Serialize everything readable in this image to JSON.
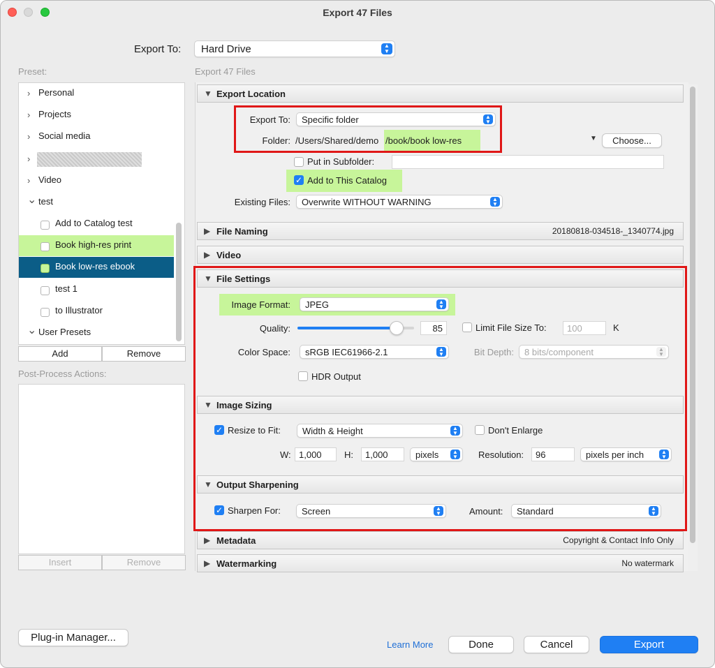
{
  "window": {
    "title": "Export 47 Files"
  },
  "header": {
    "export_to_label": "Export To:",
    "export_to_value": "Hard Drive"
  },
  "sidebar": {
    "preset_label": "Preset:",
    "items": [
      {
        "label": "Personal",
        "type": "folder"
      },
      {
        "label": "Projects",
        "type": "folder"
      },
      {
        "label": "Social media",
        "type": "folder"
      },
      {
        "label": "",
        "type": "folder-redacted"
      },
      {
        "label": "Video",
        "type": "folder"
      },
      {
        "label": "test",
        "type": "folder-open"
      },
      {
        "label": "Add to Catalog test",
        "type": "preset"
      },
      {
        "label": "Book high-res print",
        "type": "preset"
      },
      {
        "label": "Book low-res ebook",
        "type": "preset-selected"
      },
      {
        "label": "test 1",
        "type": "preset"
      },
      {
        "label": "to Illustrator",
        "type": "preset"
      },
      {
        "label": "User Presets",
        "type": "folder-open"
      }
    ],
    "add_label": "Add",
    "remove_label": "Remove",
    "post_process_label": "Post-Process Actions:",
    "insert_label": "Insert",
    "remove2_label": "Remove"
  },
  "main": {
    "subtitle": "Export 47 Files",
    "sections": {
      "export_location": "Export Location",
      "file_naming": "File Naming",
      "file_naming_info": "20180818-034518-_1340774.jpg",
      "video": "Video",
      "file_settings": "File Settings",
      "image_sizing": "Image Sizing",
      "output_sharpening": "Output Sharpening",
      "metadata": "Metadata",
      "metadata_info": "Copyright & Contact Info Only",
      "watermarking": "Watermarking",
      "watermarking_info": "No watermark"
    },
    "location": {
      "export_to_label": "Export To:",
      "export_to_value": "Specific folder",
      "folder_label": "Folder:",
      "folder_path_a": "/Users/Shared/demo",
      "folder_path_b": "/book/book low-res",
      "choose_label": "Choose...",
      "subfolder_label": "Put in Subfolder:",
      "add_catalog_label": "Add to This Catalog",
      "existing_label": "Existing Files:",
      "existing_value": "Overwrite WITHOUT WARNING"
    },
    "file_settings": {
      "format_label": "Image Format:",
      "format_value": "JPEG",
      "quality_label": "Quality:",
      "quality_value": "85",
      "limit_label": "Limit File Size To:",
      "limit_value": "100",
      "limit_unit": "K",
      "colorspace_label": "Color Space:",
      "colorspace_value": "sRGB IEC61966-2.1",
      "bitdepth_label": "Bit Depth:",
      "bitdepth_value": "8 bits/component",
      "hdr_label": "HDR Output"
    },
    "sizing": {
      "resize_label": "Resize to Fit:",
      "resize_value": "Width & Height",
      "dont_enlarge_label": "Don't Enlarge",
      "w_label": "W:",
      "w_value": "1,000",
      "h_label": "H:",
      "h_value": "1,000",
      "unit_value": "pixels",
      "resolution_label": "Resolution:",
      "resolution_value": "96",
      "resolution_unit": "pixels per inch"
    },
    "sharpening": {
      "sharpen_label": "Sharpen For:",
      "sharpen_value": "Screen",
      "amount_label": "Amount:",
      "amount_value": "Standard"
    }
  },
  "footer": {
    "plugin_label": "Plug-in Manager...",
    "learn_more": "Learn More",
    "done": "Done",
    "cancel": "Cancel",
    "export": "Export"
  },
  "state": {
    "quality": 85,
    "add_to_catalog": true,
    "resize_to_fit": true,
    "sharpen_for": true,
    "put_in_subfolder": false,
    "limit_file_size": false,
    "dont_enlarge": false,
    "hdr_output": false
  },
  "colors": {
    "accent": "#1f7ff3",
    "highlight_green": "#c7f59a",
    "selected_row": "#0b5d87",
    "annotation_red": "#e01717"
  }
}
